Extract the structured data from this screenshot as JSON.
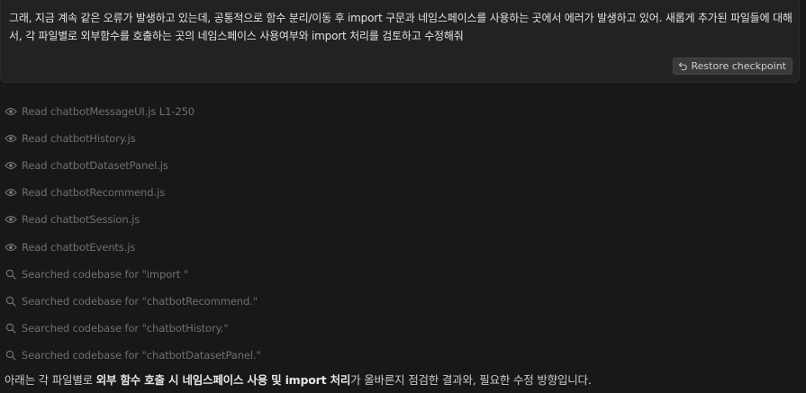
{
  "user_message": {
    "text": "그래, 지금 계속 같은 오류가 발생하고 있는데, 공통적으로 함수 분리/이동 후 import 구문과 네임스페이스를 사용하는 곳에서 에러가 발생하고 있어. 새롭게 추가된 파일들에 대해서, 각 파일별로 외부함수를 호출하는 곳의 네임스페이스 사용여부와 import 처리를 검토하고 수정해줘",
    "restore_label": "Restore checkpoint",
    "restore_icon": "undo-icon"
  },
  "steps": [
    {
      "icon": "eye-icon",
      "label": "Read chatbotMessageUI.js L1-250"
    },
    {
      "icon": "eye-icon",
      "label": "Read chatbotHistory.js"
    },
    {
      "icon": "eye-icon",
      "label": "Read chatbotDatasetPanel.js"
    },
    {
      "icon": "eye-icon",
      "label": "Read chatbotRecommend.js"
    },
    {
      "icon": "eye-icon",
      "label": "Read chatbotSession.js"
    },
    {
      "icon": "eye-icon",
      "label": "Read chatbotEvents.js"
    },
    {
      "icon": "search-icon",
      "label": "Searched codebase for \"import \""
    },
    {
      "icon": "search-icon",
      "label": "Searched codebase for \"chatbotRecommend.\""
    },
    {
      "icon": "search-icon",
      "label": "Searched codebase for \"chatbotHistory.\""
    },
    {
      "icon": "search-icon",
      "label": "Searched codebase for \"chatbotDatasetPanel.\""
    }
  ],
  "summary": {
    "prefix": "아래는 각 파일별로 ",
    "bold": "외부 함수 호출 시 네임스페이스 사용 및 import 처리",
    "suffix": "가 올바른지 점검한 결과와, 필요한 수정 방향입니다."
  },
  "colors": {
    "background": "#181818",
    "message_bg": "#222222",
    "step_text": "#6f6f6f",
    "text": "#e2e2e2"
  }
}
